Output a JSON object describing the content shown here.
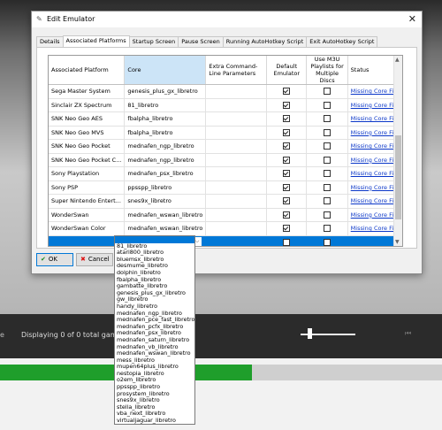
{
  "background": {
    "left_text": "e",
    "status_text": "Displaying 0 of 0 total games",
    "progress_fraction": 0.57
  },
  "dialog": {
    "title": "Edit Emulator",
    "tabs": [
      "Details",
      "Associated Platforms",
      "Startup Screen",
      "Pause Screen",
      "Running AutoHotkey Script",
      "Exit AutoHotkey Script"
    ],
    "active_tab": 1,
    "columns": {
      "platform": "Associated Platform",
      "core": "Core",
      "extra": "Extra Command-Line Parameters",
      "default": "Default Emulator",
      "m3u": "Use M3U Playlists for Multiple Discs",
      "status": "Status"
    },
    "rows": [
      {
        "platform": "Sega Master System",
        "core": "genesis_plus_gx_libretro",
        "default": true,
        "m3u": false,
        "status": "Missing Core File"
      },
      {
        "platform": "Sinclair ZX Spectrum",
        "core": "81_libretro",
        "default": true,
        "m3u": false,
        "status": "Missing Core File"
      },
      {
        "platform": "SNK Neo Geo AES",
        "core": "fbalpha_libretro",
        "default": true,
        "m3u": false,
        "status": "Missing Core File"
      },
      {
        "platform": "SNK Neo Geo MVS",
        "core": "fbalpha_libretro",
        "default": true,
        "m3u": false,
        "status": "Missing Core File"
      },
      {
        "platform": "SNK Neo Geo Pocket",
        "core": "mednafen_ngp_libretro",
        "default": true,
        "m3u": false,
        "status": "Missing Core File"
      },
      {
        "platform": "SNK Neo Geo Pocket C...",
        "core": "mednafen_ngp_libretro",
        "default": true,
        "m3u": false,
        "status": "Missing Core File"
      },
      {
        "platform": "Sony Playstation",
        "core": "mednafen_psx_libretro",
        "default": true,
        "m3u": false,
        "status": "Missing Core File"
      },
      {
        "platform": "Sony PSP",
        "core": "ppsspp_libretro",
        "default": true,
        "m3u": false,
        "status": "Missing Core File"
      },
      {
        "platform": "Super Nintendo Entert...",
        "core": "snes9x_libretro",
        "default": true,
        "m3u": false,
        "status": "Missing Core File"
      },
      {
        "platform": "WonderSwan",
        "core": "mednafen_wswan_libretro",
        "default": true,
        "m3u": false,
        "status": "Missing Core File"
      },
      {
        "platform": "WonderSwan Color",
        "core": "mednafen_wswan_libretro",
        "default": true,
        "m3u": false,
        "status": "Missing Core File"
      }
    ],
    "ok_label": "OK",
    "cancel_label": "Cancel"
  },
  "dropdown_options": [
    "",
    "81_libretro",
    "atari800_libretro",
    "bluemsx_libretro",
    "desmume_libretro",
    "dolphin_libretro",
    "fbalpha_libretro",
    "gambatte_libretro",
    "genesis_plus_gx_libretro",
    "gw_libretro",
    "handy_libretro",
    "mednafen_ngp_libretro",
    "mednafen_pce_fast_libretro",
    "mednafen_pcfx_libretro",
    "mednafen_psx_libretro",
    "mednafen_saturn_libretro",
    "mednafen_vb_libretro",
    "mednafen_wswan_libretro",
    "mess_libretro",
    "mupen64plus_libretro",
    "nestopia_libretro",
    "o2em_libretro",
    "ppsspp_libretro",
    "prosystem_libretro",
    "snes9x_libretro",
    "stella_libretro",
    "vba_next_libretro",
    "virtualjaguar_libretro"
  ],
  "icons": {
    "title": "pencil-icon",
    "close": "close-icon",
    "ok": "checkmark-icon",
    "cancel": "x-icon",
    "dropdown": "chevron-down-icon"
  },
  "colors": {
    "selection": "#0078d7",
    "link": "#0a36c8",
    "progress": "#1f9e2b"
  }
}
